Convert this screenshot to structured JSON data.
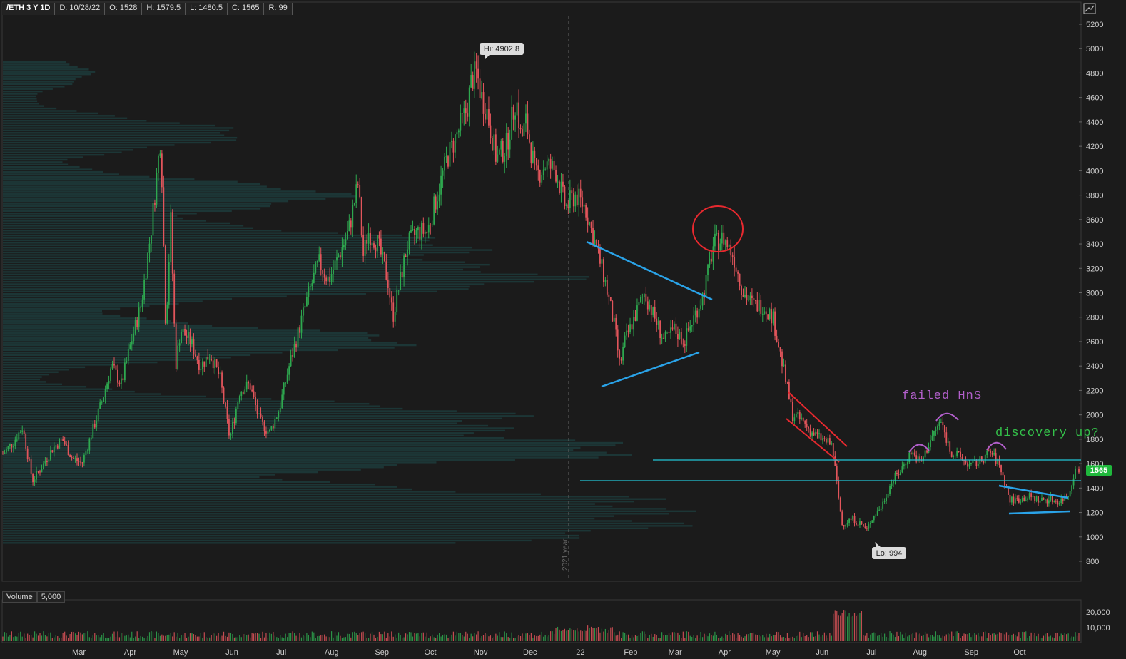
{
  "header": {
    "symbol": "/ETH 3 Y 1D",
    "date": "D: 10/28/22",
    "open": "O: 1528",
    "high": "H: 1579.5",
    "low": "L: 1480.5",
    "close": "C: 1565",
    "range": "R: 99"
  },
  "volume_header": {
    "label": "Volume",
    "scale": "5,000"
  },
  "colors": {
    "up": "#2ea84f",
    "down": "#e2555b",
    "trend": "#2aa3e8",
    "flag": "#e8292f",
    "hns": "#b25fcb",
    "level": "#22c6d6",
    "note_green": "#34c24a",
    "last_price_bg": "#1fb83c",
    "profile": "#1d3a3a"
  },
  "chart_data": {
    "type": "candlestick",
    "y_ticks": [
      "5200",
      "5000",
      "4800",
      "4600",
      "4400",
      "4200",
      "4000",
      "3800",
      "3600",
      "3400",
      "3200",
      "3000",
      "2800",
      "2600",
      "2400",
      "2200",
      "2000",
      "1800",
      "1600",
      "1400",
      "1200",
      "1000",
      "800"
    ],
    "ylim": [
      650,
      5300
    ],
    "volume_ticks": [
      "20,000",
      "10,000"
    ],
    "x_labels": [
      {
        "t": 0.077,
        "label": "Mar"
      },
      {
        "t": 0.129,
        "label": "Apr"
      },
      {
        "t": 0.18,
        "label": "May"
      },
      {
        "t": 0.232,
        "label": "Jun"
      },
      {
        "t": 0.282,
        "label": "Jul"
      },
      {
        "t": 0.333,
        "label": "Aug"
      },
      {
        "t": 0.384,
        "label": "Sep"
      },
      {
        "t": 0.433,
        "label": "Oct"
      },
      {
        "t": 0.484,
        "label": "Nov"
      },
      {
        "t": 0.534,
        "label": "Dec"
      },
      {
        "t": 0.585,
        "label": "22"
      },
      {
        "t": 0.636,
        "label": "Feb"
      },
      {
        "t": 0.681,
        "label": "Mar"
      },
      {
        "t": 0.731,
        "label": "Apr"
      },
      {
        "t": 0.78,
        "label": "May"
      },
      {
        "t": 0.83,
        "label": "Jun"
      },
      {
        "t": 0.88,
        "label": "Jul"
      },
      {
        "t": 0.929,
        "label": "Aug"
      },
      {
        "t": 0.981,
        "label": "Sep"
      },
      {
        "t": 1.03,
        "label": "Oct"
      }
    ],
    "price_path": [
      [
        0.0,
        1680
      ],
      [
        0.01,
        1770
      ],
      [
        0.02,
        1900
      ],
      [
        0.03,
        1460
      ],
      [
        0.04,
        1580
      ],
      [
        0.05,
        1720
      ],
      [
        0.06,
        1800
      ],
      [
        0.07,
        1650
      ],
      [
        0.08,
        1600
      ],
      [
        0.09,
        1850
      ],
      [
        0.1,
        2100
      ],
      [
        0.11,
        2400
      ],
      [
        0.12,
        2250
      ],
      [
        0.13,
        2600
      ],
      [
        0.14,
        2900
      ],
      [
        0.15,
        3500
      ],
      [
        0.155,
        3900
      ],
      [
        0.16,
        4300
      ],
      [
        0.165,
        2700
      ],
      [
        0.17,
        3600
      ],
      [
        0.175,
        2400
      ],
      [
        0.18,
        2700
      ],
      [
        0.19,
        2600
      ],
      [
        0.2,
        2400
      ],
      [
        0.21,
        2500
      ],
      [
        0.22,
        2300
      ],
      [
        0.23,
        1800
      ],
      [
        0.24,
        2200
      ],
      [
        0.25,
        2250
      ],
      [
        0.26,
        1950
      ],
      [
        0.27,
        1850
      ],
      [
        0.28,
        2050
      ],
      [
        0.29,
        2400
      ],
      [
        0.3,
        2700
      ],
      [
        0.31,
        3000
      ],
      [
        0.32,
        3250
      ],
      [
        0.33,
        3100
      ],
      [
        0.34,
        3300
      ],
      [
        0.35,
        3500
      ],
      [
        0.36,
        3900
      ],
      [
        0.365,
        3300
      ],
      [
        0.37,
        3500
      ],
      [
        0.38,
        3400
      ],
      [
        0.39,
        3100
      ],
      [
        0.395,
        2800
      ],
      [
        0.4,
        3000
      ],
      [
        0.41,
        3400
      ],
      [
        0.42,
        3500
      ],
      [
        0.43,
        3500
      ],
      [
        0.44,
        3800
      ],
      [
        0.45,
        4100
      ],
      [
        0.46,
        4300
      ],
      [
        0.47,
        4500
      ],
      [
        0.475,
        4750
      ],
      [
        0.48,
        4800
      ],
      [
        0.485,
        4600
      ],
      [
        0.49,
        4500
      ],
      [
        0.5,
        4100
      ],
      [
        0.51,
        4200
      ],
      [
        0.52,
        4600
      ],
      [
        0.525,
        4250
      ],
      [
        0.53,
        4400
      ],
      [
        0.54,
        3950
      ],
      [
        0.55,
        4050
      ],
      [
        0.56,
        4000
      ],
      [
        0.57,
        3700
      ],
      [
        0.58,
        3800
      ],
      [
        0.59,
        3700
      ],
      [
        0.6,
        3400
      ],
      [
        0.61,
        3100
      ],
      [
        0.62,
        2700
      ],
      [
        0.625,
        2400
      ],
      [
        0.63,
        2600
      ],
      [
        0.64,
        2800
      ],
      [
        0.65,
        3000
      ],
      [
        0.66,
        2800
      ],
      [
        0.67,
        2600
      ],
      [
        0.68,
        2700
      ],
      [
        0.69,
        2600
      ],
      [
        0.7,
        2800
      ],
      [
        0.71,
        3000
      ],
      [
        0.72,
        3400
      ],
      [
        0.73,
        3450
      ],
      [
        0.74,
        3300
      ],
      [
        0.75,
        3000
      ],
      [
        0.76,
        2900
      ],
      [
        0.77,
        2900
      ],
      [
        0.78,
        2800
      ],
      [
        0.79,
        2400
      ],
      [
        0.8,
        2000
      ],
      [
        0.81,
        1950
      ],
      [
        0.82,
        1850
      ],
      [
        0.83,
        1800
      ],
      [
        0.84,
        1750
      ],
      [
        0.85,
        1100
      ],
      [
        0.86,
        1150
      ],
      [
        0.87,
        1100
      ],
      [
        0.875,
        1050
      ],
      [
        0.88,
        1150
      ],
      [
        0.89,
        1250
      ],
      [
        0.9,
        1450
      ],
      [
        0.91,
        1550
      ],
      [
        0.92,
        1700
      ],
      [
        0.93,
        1600
      ],
      [
        0.94,
        1800
      ],
      [
        0.95,
        1950
      ],
      [
        0.96,
        1700
      ],
      [
        0.97,
        1650
      ],
      [
        0.98,
        1580
      ],
      [
        0.99,
        1620
      ],
      [
        1.0,
        1700
      ],
      [
        1.01,
        1580
      ],
      [
        1.02,
        1300
      ],
      [
        1.03,
        1310
      ],
      [
        1.04,
        1330
      ],
      [
        1.05,
        1300
      ],
      [
        1.06,
        1310
      ],
      [
        1.07,
        1290
      ],
      [
        1.08,
        1350
      ],
      [
        1.085,
        1530
      ],
      [
        1.09,
        1565
      ]
    ],
    "annotations": {
      "high_label": "Hi: 4902.8",
      "low_label": "Lo: 994",
      "year_label": "2021 year",
      "failed_hns": "failed HnS",
      "discovery": "discovery up?",
      "last_price": "1565"
    }
  }
}
